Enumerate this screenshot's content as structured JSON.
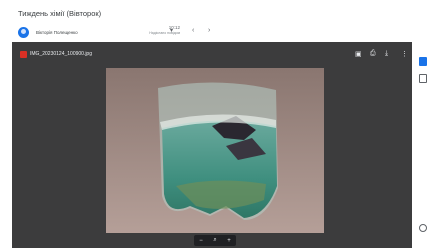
{
  "header": {
    "subject": "Тиждень хімії (Вівторок)",
    "sender_name": "Вікторія Полещенко",
    "date": "10:12",
    "date_sub": "Надіслано повідом",
    "dropdown_icon": "arrow-down-icon",
    "prev_icon": "chevron-left-icon",
    "next_icon": "chevron-right-icon"
  },
  "viewer": {
    "file_name": "IMG_20230124_100900.jpg",
    "tools": {
      "comment": "▣",
      "print": "⎙",
      "download": "⤓",
      "more": "⋮"
    },
    "zoom": {
      "out": "−",
      "fit": "⌕",
      "in": "+"
    }
  },
  "sidebar": {
    "chevron": "›"
  },
  "colors": {
    "accent": "#1a73e8",
    "viewer_bg": "#3c3c3d",
    "file_icon": "#d93025"
  }
}
